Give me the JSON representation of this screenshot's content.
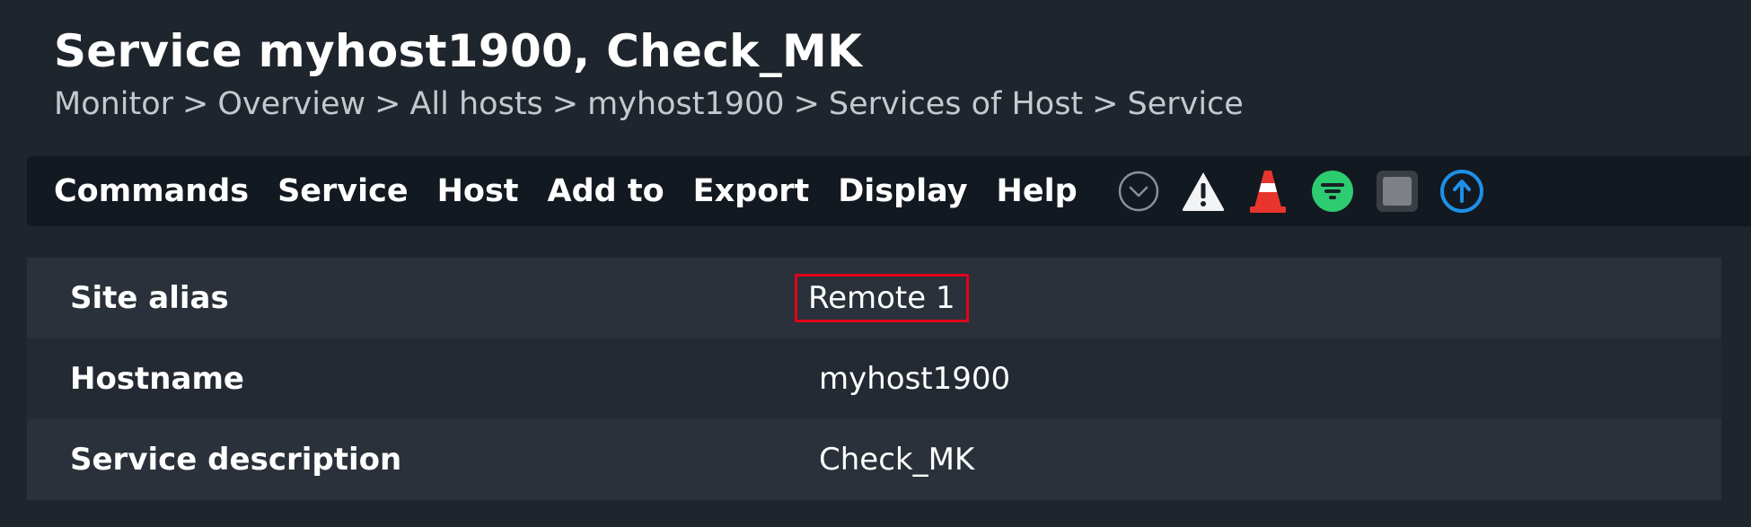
{
  "header": {
    "title": "Service myhost1900, Check_MK",
    "breadcrumb": [
      "Monitor",
      "Overview",
      "All hosts",
      "myhost1900",
      "Services of Host",
      "Service"
    ],
    "separator": ">"
  },
  "menubar": {
    "items": [
      "Commands",
      "Service",
      "Host",
      "Add to",
      "Export",
      "Display",
      "Help"
    ],
    "icons": [
      "chevron-down-circle-icon",
      "warning-triangle-icon",
      "traffic-cone-icon",
      "filter-icon",
      "square-toggle-icon",
      "arrow-up-circle-icon"
    ]
  },
  "details": {
    "rows": [
      {
        "label": "Site alias",
        "value": "Remote 1"
      },
      {
        "label": "Hostname",
        "value": "myhost1900"
      },
      {
        "label": "Service description",
        "value": "Check_MK"
      }
    ]
  },
  "colors": {
    "background": "#1f252d",
    "menubar": "#131920",
    "highlight_border": "#e3001b",
    "filter_green": "#2ecc71",
    "arrow_blue": "#1e90e8",
    "cone_red": "#e8362e"
  }
}
